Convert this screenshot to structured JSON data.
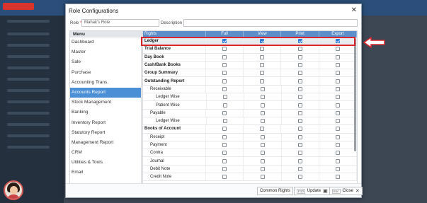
{
  "dialog": {
    "title": "Role Configurations",
    "close_glyph": "✕"
  },
  "role": {
    "label": "Role",
    "required_mark": "*",
    "value": "Mahak's Role",
    "description_label": "Description",
    "description_value": ""
  },
  "menu": {
    "header": "Menu",
    "items": [
      {
        "label": "Dashboard",
        "active": false
      },
      {
        "label": "Master",
        "active": false
      },
      {
        "label": "Sale",
        "active": false
      },
      {
        "label": "Purchase",
        "active": false
      },
      {
        "label": "Accounting Trans.",
        "active": false
      },
      {
        "label": "Accounts Report",
        "active": true
      },
      {
        "label": "Stock Management",
        "active": false
      },
      {
        "label": "Banking",
        "active": false
      },
      {
        "label": "Inventory Report",
        "active": false
      },
      {
        "label": "Statutory Report",
        "active": false
      },
      {
        "label": "Management Report",
        "active": false
      },
      {
        "label": "CRM",
        "active": false
      },
      {
        "label": "Utilities & Tools",
        "active": false
      },
      {
        "label": "Email",
        "active": false
      }
    ]
  },
  "rights": {
    "headers": [
      "Rights",
      "Full",
      "View",
      "Print",
      "Export"
    ],
    "rows": [
      {
        "label": "Ledger",
        "level": 0,
        "bold": true,
        "checked": [
          true,
          true,
          true,
          true
        ],
        "highlight": true
      },
      {
        "label": "Trial Balance",
        "level": 0,
        "bold": true,
        "checked": [
          false,
          false,
          false,
          false
        ]
      },
      {
        "label": "Day Book",
        "level": 0,
        "bold": true,
        "checked": [
          false,
          false,
          false,
          false
        ]
      },
      {
        "label": "Cash/Bank Books",
        "level": 0,
        "bold": true,
        "checked": [
          false,
          false,
          false,
          false
        ]
      },
      {
        "label": "Group Summary",
        "level": 0,
        "bold": true,
        "checked": [
          false,
          false,
          false,
          false
        ]
      },
      {
        "label": "Outstanding Report",
        "level": 0,
        "bold": true,
        "checked": [
          false,
          false,
          false,
          false
        ]
      },
      {
        "label": "Receivable",
        "level": 1,
        "bold": false,
        "checked": [
          false,
          false,
          false,
          false
        ]
      },
      {
        "label": "Ledger Wise",
        "level": 2,
        "bold": false,
        "checked": [
          false,
          false,
          false,
          false
        ]
      },
      {
        "label": "Patient Wise",
        "level": 2,
        "bold": false,
        "checked": [
          false,
          false,
          false,
          false
        ]
      },
      {
        "label": "Payable",
        "level": 1,
        "bold": false,
        "checked": [
          false,
          false,
          false,
          false
        ]
      },
      {
        "label": "Ledger Wise",
        "level": 2,
        "bold": false,
        "checked": [
          false,
          false,
          false,
          false
        ]
      },
      {
        "label": "Books of Account",
        "level": 0,
        "bold": true,
        "checked": [
          false,
          false,
          false,
          false
        ]
      },
      {
        "label": "Receipt",
        "level": 1,
        "bold": false,
        "checked": [
          false,
          false,
          false,
          false
        ]
      },
      {
        "label": "Payment",
        "level": 1,
        "bold": false,
        "checked": [
          false,
          false,
          false,
          false
        ]
      },
      {
        "label": "Contra",
        "level": 1,
        "bold": false,
        "checked": [
          false,
          false,
          false,
          false
        ]
      },
      {
        "label": "Journal",
        "level": 1,
        "bold": false,
        "checked": [
          false,
          false,
          false,
          false
        ]
      },
      {
        "label": "Debit Note",
        "level": 1,
        "bold": false,
        "checked": [
          false,
          false,
          false,
          false
        ]
      },
      {
        "label": "Credit Note",
        "level": 1,
        "bold": false,
        "checked": [
          false,
          false,
          false,
          false
        ]
      }
    ]
  },
  "footer": {
    "common_rights": "Common Rights",
    "update_key": "F10",
    "update_label": "Update",
    "close_key": "Esc",
    "close_label": "Close"
  },
  "colors": {
    "highlight_box": "#d9262c",
    "active_menu": "#4b8fd6",
    "header_bar": "#5d8ec9"
  }
}
